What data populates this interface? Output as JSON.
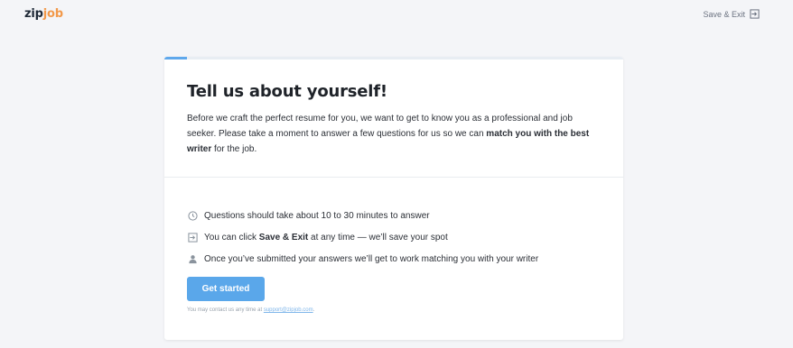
{
  "brand": {
    "logo_part1": "zip",
    "logo_part2": "job",
    "accent_color": "#f2994a",
    "primary_color": "#5aa7ea"
  },
  "header": {
    "save_exit_label": "Save & Exit",
    "save_exit_icon": "exit-arrow-icon"
  },
  "card": {
    "progress_fraction": 0.05,
    "title": "Tell us about yourself!",
    "intro_part1": "Before we craft the perfect resume for you, we want to get to know you as a professional and job seeker. Please take a moment to answer a few questions for us so we can ",
    "intro_bold": "match you with the best writer",
    "intro_part2": " for the job.",
    "info_items": [
      {
        "icon": "clock-icon",
        "text_before": "Questions should take about 10 to 30 minutes to answer",
        "bold": "",
        "text_after": ""
      },
      {
        "icon": "exit-arrow-icon",
        "text_before": "You can click ",
        "bold": "Save & Exit",
        "text_after": " at any time — we’ll save your spot"
      },
      {
        "icon": "person-icon",
        "text_before": "Once you’ve submitted your answers we’ll get to work matching you with your writer",
        "bold": "",
        "text_after": ""
      }
    ],
    "cta_label": "Get started",
    "contact_text": "You may contact us any time at ",
    "contact_email": "support@zipjob.com",
    "contact_suffix": "."
  }
}
